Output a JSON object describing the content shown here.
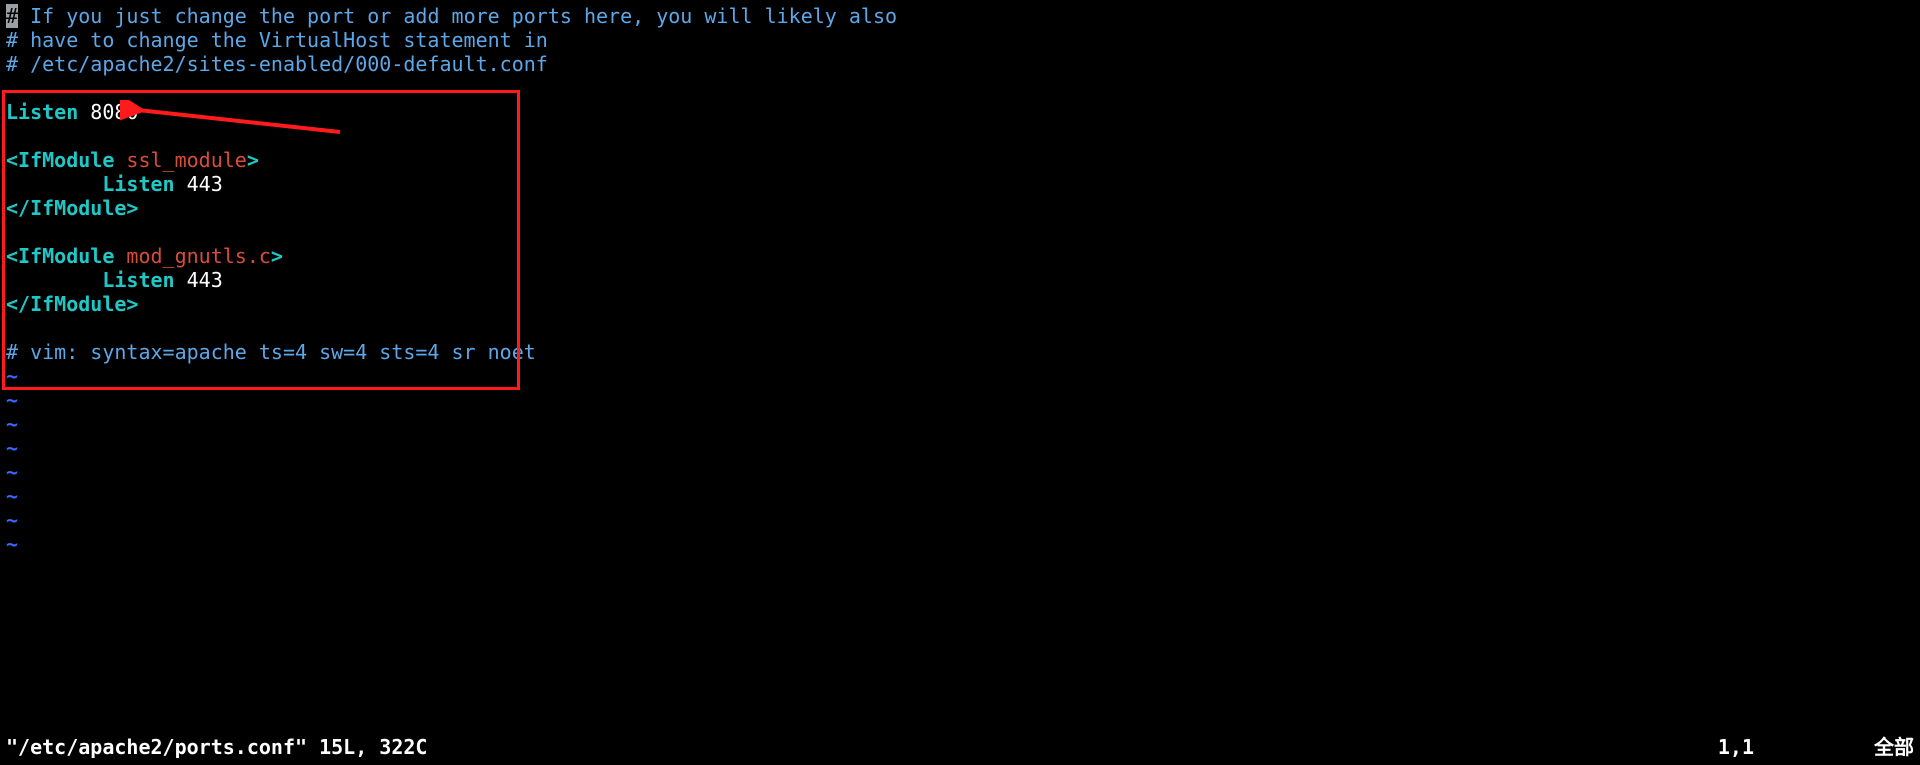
{
  "comments": {
    "line1a": "#",
    "line1b": " If you just change the port or add more ports here, you will likely also",
    "line2": "# have to change the VirtualHost statement in",
    "line3": "# /etc/apache2/sites-enabled/000-default.conf",
    "vimline": "# vim: syntax=apache ts=4 sw=4 sts=4 sr noet"
  },
  "conf": {
    "listen_kw": "Listen",
    "listen_port": "8080",
    "if_open": "<",
    "if_kw": "IfModule",
    "ssl_mod": "ssl_module",
    "gnutls_mod": "mod_gnutls.c",
    "close_angle": ">",
    "listen443": "443",
    "if_close_open": "</",
    "if_close_kw": "IfModule",
    "if_close_angle": ">"
  },
  "tilde": "~",
  "status": {
    "file": "\"/etc/apache2/ports.conf\" 15L, 322C",
    "pos": "1,1",
    "scroll": "全部"
  },
  "annotation": {
    "arrow_color": "#ff1b1b",
    "box_color": "#ff1b1b"
  }
}
